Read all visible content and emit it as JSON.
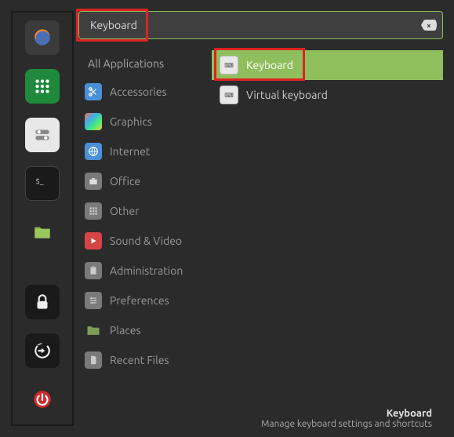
{
  "search": {
    "value": "Keyboard"
  },
  "categories": {
    "header": "All Applications",
    "items": [
      {
        "label": "Accessories",
        "icon": "accessories",
        "bg": "#4a90d9"
      },
      {
        "label": "Graphics",
        "icon": "graphics",
        "bg": "linear"
      },
      {
        "label": "Internet",
        "icon": "internet",
        "bg": "#4a90d9"
      },
      {
        "label": "Office",
        "icon": "office",
        "bg": "#7a7a7a"
      },
      {
        "label": "Other",
        "icon": "other",
        "bg": "#7a7a7a"
      },
      {
        "label": "Sound & Video",
        "icon": "sound",
        "bg": "#d64545"
      },
      {
        "label": "Administration",
        "icon": "admin",
        "bg": "#7a7a7a"
      },
      {
        "label": "Preferences",
        "icon": "prefs",
        "bg": "#7a7a7a"
      },
      {
        "label": "Places",
        "icon": "places",
        "bg": "#7f9b5a"
      },
      {
        "label": "Recent Files",
        "icon": "recent",
        "bg": "#7a7a7a"
      }
    ]
  },
  "results": [
    {
      "label": "Keyboard",
      "selected": true
    },
    {
      "label": "Virtual keyboard",
      "selected": false
    }
  ],
  "footer": {
    "title": "Keyboard",
    "description": "Manage keyboard settings and shortcuts"
  }
}
